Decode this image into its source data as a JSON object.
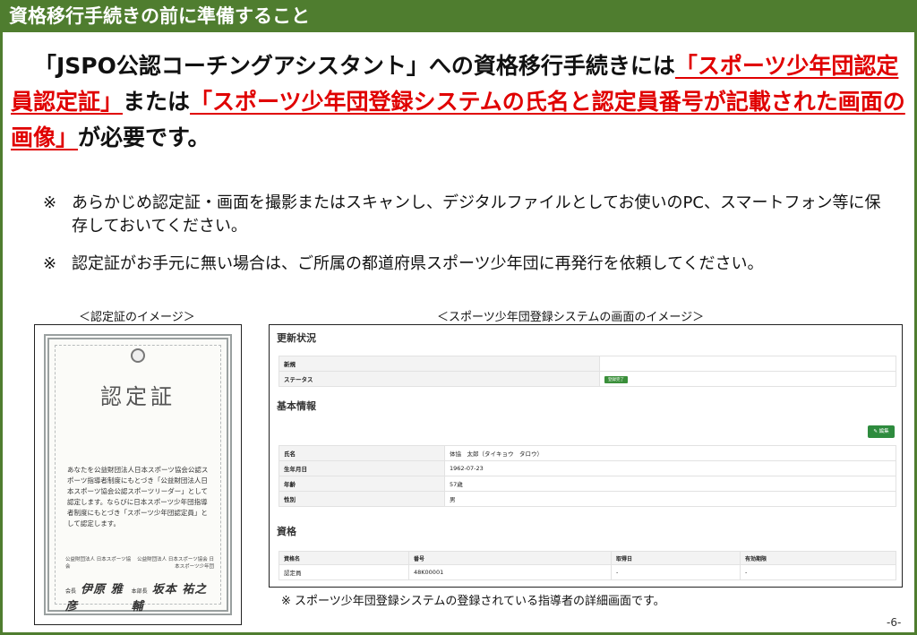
{
  "header": {
    "title": "資格移行手続きの前に準備すること"
  },
  "lead": {
    "part1": "「JSPO公認コーチングアシスタント」への資格移行手続きには",
    "red1": "「スポーツ少年団認定員認定証」",
    "part2": "または",
    "red2": "「スポーツ少年団登録システムの氏名と認定員番号が記載された画面の画像」",
    "part3": "が必要です。"
  },
  "notes": [
    {
      "mark": "※",
      "text": "あらかじめ認定証・画面を撮影またはスキャンし、デジタルファイルとしてお使いのPC、スマートフォン等に保存しておいてください。"
    },
    {
      "mark": "※",
      "text": "認定証がお手元に無い場合は、ご所属の都道府県スポーツ少年団に再発行を依頼してください。"
    }
  ],
  "captions": {
    "certificate": "＜認定証のイメージ＞",
    "screen": "＜スポーツ少年団登録システムの画面のイメージ＞"
  },
  "certificate": {
    "title": "認定証",
    "body": "あなたを公益財団法人日本スポーツ協会公認スポーツ指導者制度にもとづき「公益財団法人日本スポーツ協会公認スポーツリーダー」として認定します。ならびに日本スポーツ少年団指導者制度にもとづき「スポーツ少年団認定員」として認定します。",
    "org_left": "公益財団法人 日本スポーツ協会",
    "org_right": "公益財団法人 日本スポーツ協会 日本スポーツ少年団",
    "role_left": "会長",
    "sig_left": "伊原 雅彦",
    "role_right": "本部長",
    "sig_right": "坂本 祐之輔"
  },
  "screen": {
    "status_heading": "更新状況",
    "status_rows": [
      {
        "label": "新規",
        "value": ""
      },
      {
        "label": "ステータス",
        "value": "登録完了"
      }
    ],
    "basic_heading": "基本情報",
    "edit_button": "✎ 編集",
    "basic_rows": [
      {
        "label": "氏名",
        "value": "体協　太郎（タイキョウ　タロウ）"
      },
      {
        "label": "生年月日",
        "value": "1962-07-23"
      },
      {
        "label": "年齢",
        "value": "57歳"
      },
      {
        "label": "性別",
        "value": "男"
      }
    ],
    "qual_heading": "資格",
    "qual_columns": [
      "資格名",
      "番号",
      "取得日",
      "有効期限"
    ],
    "qual_rows": [
      [
        "認定員",
        "48K00001",
        "-",
        "-"
      ]
    ]
  },
  "screen_note": "※ スポーツ少年団登録システムの登録されている指導者の詳細画面です。",
  "page_number": "-6-"
}
